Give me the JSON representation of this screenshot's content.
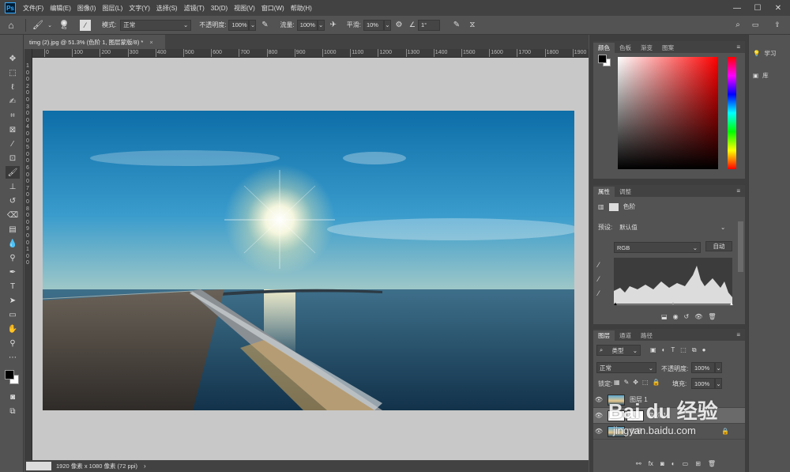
{
  "app": {
    "logo": "Ps"
  },
  "menu": [
    "文件(F)",
    "编辑(E)",
    "图像(I)",
    "图层(L)",
    "文字(Y)",
    "选择(S)",
    "滤镜(T)",
    "3D(D)",
    "视图(V)",
    "窗口(W)",
    "帮助(H)"
  ],
  "window_controls": {
    "minimize": "—",
    "maximize": "☐",
    "close": "✕"
  },
  "options": {
    "brush_size": "45",
    "mode_label": "模式:",
    "mode_value": "正常",
    "opacity_label": "不透明度:",
    "opacity_value": "100%",
    "flow_label": "流量:",
    "flow_value": "100%",
    "smooth_label": "平滑:",
    "smooth_value": "10%",
    "angle_value": "1°"
  },
  "document": {
    "tab_title": "timg (2).jpg @ 51.3% (色阶 1, 图层蒙版/8) *",
    "close": "×"
  },
  "ruler_h": [
    "0",
    "100",
    "200",
    "300",
    "400",
    "500",
    "600",
    "700",
    "800",
    "900",
    "1000",
    "1100",
    "1200",
    "1300",
    "1400",
    "1500",
    "1600",
    "1700",
    "1800",
    "1900"
  ],
  "ruler_v": [
    "1",
    "0",
    "0",
    "2",
    "0",
    "0",
    "3",
    "0",
    "0",
    "4",
    "0",
    "0",
    "5",
    "0",
    "0",
    "6",
    "0",
    "0",
    "7",
    "0",
    "0",
    "8",
    "0",
    "0",
    "9",
    "0",
    "0",
    "1",
    "0",
    "0"
  ],
  "status": {
    "dimensions": "1920 像素 x 1080 像素 (72 ppi)",
    "arrow": "›"
  },
  "color_panel": {
    "tabs": [
      "颜色",
      "色板",
      "渐变",
      "图案"
    ],
    "active": 0
  },
  "properties_panel": {
    "tabs": [
      "属性",
      "调整"
    ],
    "active": 0,
    "type_label": "色阶",
    "preset_label": "预设:",
    "preset_value": "默认值",
    "channel_value": "RGB",
    "auto_label": "自动"
  },
  "layers_panel": {
    "tabs": [
      "图层",
      "通道",
      "路径"
    ],
    "active": 0,
    "filter_label": "类型",
    "blend_value": "正常",
    "opacity_label": "不透明度:",
    "opacity_value": "100%",
    "lock_label": "锁定:",
    "fill_label": "填充:",
    "fill_value": "100%",
    "layers": [
      {
        "name": "图层 1"
      },
      {
        "name": "色阶 1"
      },
      {
        "name": "背景"
      }
    ]
  },
  "learn_panel": {
    "items": [
      "学习",
      "库"
    ]
  },
  "watermark": {
    "brand": "Bai du 经验",
    "url": "jingyan.baidu.com"
  },
  "colors": {
    "accent": "#31a8ff",
    "fg": "#000000",
    "bg": "#ffffff"
  }
}
